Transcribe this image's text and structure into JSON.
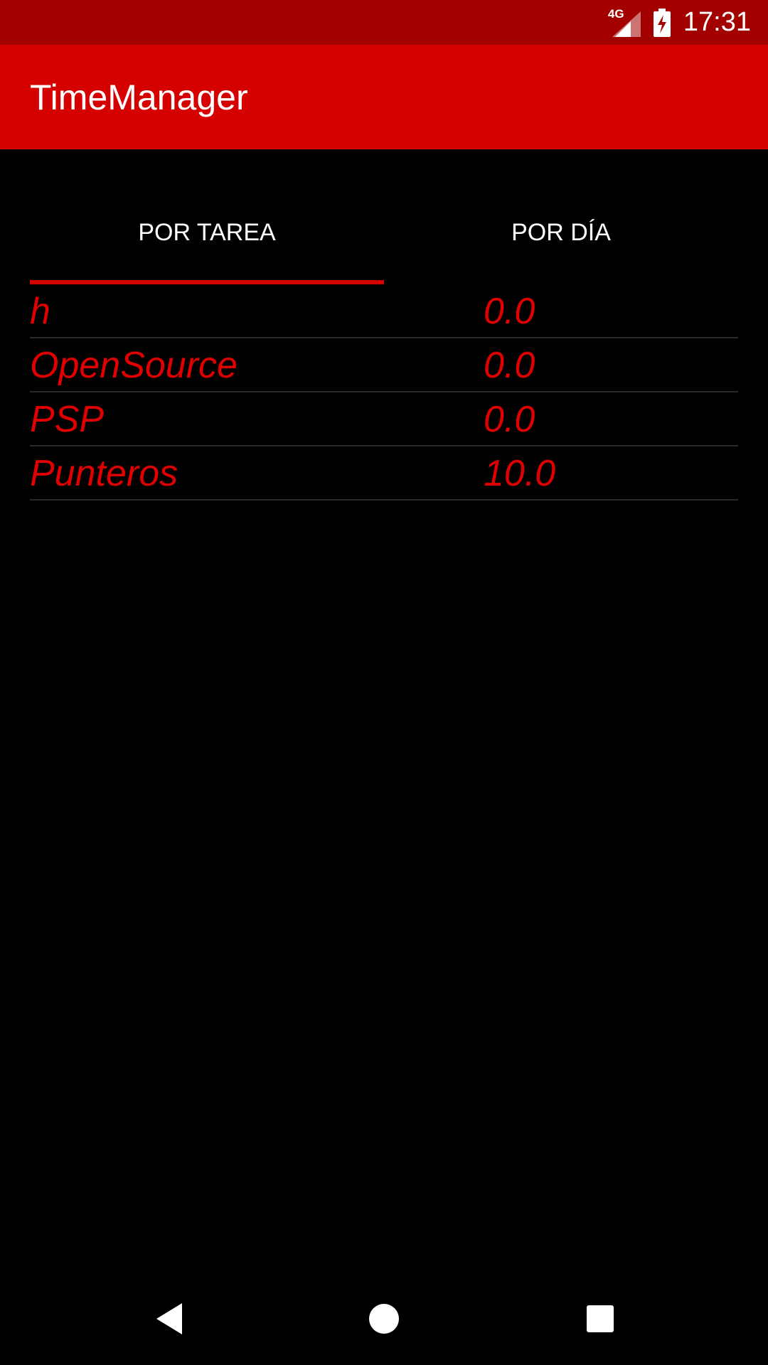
{
  "status_bar": {
    "network": "4G",
    "time": "17:31",
    "icons": [
      "signal-icon",
      "battery-charging-icon"
    ]
  },
  "app_bar": {
    "title": "TimeManager"
  },
  "tabs": [
    {
      "label": "POR TAREA",
      "selected": true
    },
    {
      "label": "POR DÍA",
      "selected": false
    }
  ],
  "tasks": [
    {
      "name": "h",
      "hours": "0.0"
    },
    {
      "name": "OpenSource",
      "hours": "0.0"
    },
    {
      "name": "PSP",
      "hours": "0.0"
    },
    {
      "name": "Punteros",
      "hours": "10.0"
    }
  ],
  "nav_bar": {
    "icons": [
      "back-icon",
      "home-icon",
      "recents-icon"
    ]
  },
  "colors": {
    "status_bar": "#a30000",
    "app_bar": "#d50000",
    "accent": "#e00000",
    "background": "#000000"
  }
}
